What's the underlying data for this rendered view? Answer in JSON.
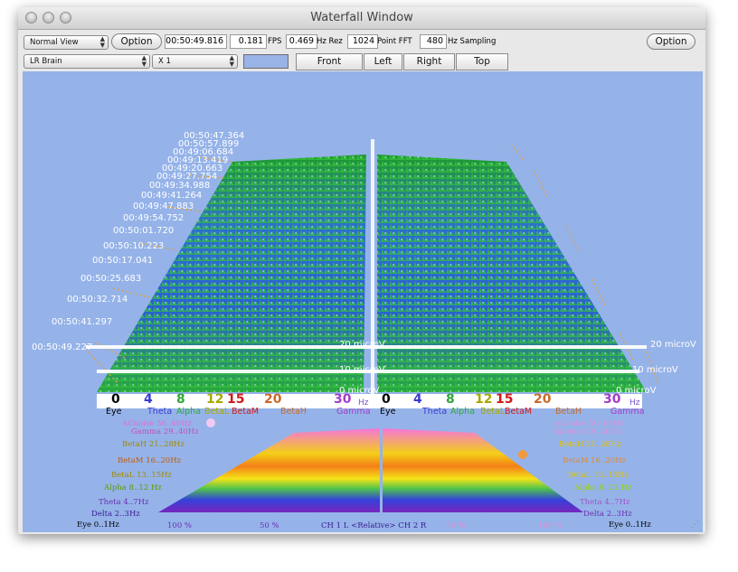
{
  "window": {
    "title": "Waterfall Window"
  },
  "toolbar": {
    "view_mode": "Normal View",
    "option_label": "Option",
    "time_value": "00:50:49.816",
    "fps_value": "0.181",
    "fps_label": "FPS",
    "rez_value": "0.469",
    "rez_label": "Hz Rez",
    "fft_value": "1024",
    "fft_label": "Point FFT",
    "sampling_value": "480",
    "sampling_label": "Hz Sampling",
    "option_right_label": "Option",
    "montage": "LR Brain",
    "scale": "X 1",
    "accent_color": "#9ab3e6",
    "view_buttons": [
      "Front",
      "Left",
      "Right",
      "Top"
    ]
  },
  "waterfall": {
    "timestamps": [
      "00:50:47.364",
      "00:50:57.899",
      "00:49:06.684",
      "00:49:13.419",
      "00:49:20.663",
      "00:49:27.754",
      "00:49:34.988",
      "00:49:41.264",
      "00:49:47.883",
      "00:49:54.752",
      "00:50:01.720",
      "00:50:10.223",
      "00:50:17.041",
      "00:50:25.683",
      "00:50:32.714",
      "00:50:41.297",
      "00:50:49.227"
    ],
    "microvolt_labels": [
      "20 microV",
      "10 microV",
      "0 microV"
    ],
    "microvolt_labels_right": [
      "20 microV",
      "10 microV",
      "0 microV"
    ],
    "freq_ticks_left": [
      "0",
      "4",
      "8",
      "12",
      "15",
      "20",
      "30"
    ],
    "freq_ticks_right": [
      "0",
      "4",
      "8",
      "12",
      "15",
      "20",
      "30"
    ],
    "hz_unit": "Hz",
    "bands_left": [
      "Eye",
      "Theta",
      "Alpha",
      "BetaL",
      "BetaM",
      "BetaH",
      "Gamma"
    ],
    "bands_right": [
      "Eye",
      "Theta",
      "Alpha",
      "BetaL",
      "BetaM",
      "BetaH",
      "Gamma"
    ]
  },
  "band_rows": {
    "left": [
      "ACnoise 50..60Hz",
      "Gamma 29..40Hz",
      "BetaH 21..28Hz",
      "BetaM 16..20Hz",
      "BetaL 13..15Hz",
      "Alpha 8..12 Hz",
      "Theta 4..7Hz",
      "Delta 2..3Hz",
      "Eye 0..1Hz"
    ],
    "right": [
      "ACnoise 50..60Hz",
      "Gamma 29..40Hz",
      "BetaH 21..28Hz",
      "BetaM 16..20Hz",
      "BetaL 13..15Hz",
      "Alpha 8..12 Hz",
      "Theta 4..7Hz",
      "Delta 2..3Hz",
      "Eye 0..1Hz"
    ],
    "row_colors": [
      "#d96fd4",
      "#c64dc0",
      "#e0c100",
      "#e06a00",
      "#d6a300",
      "#7bb800",
      "#9a56c8",
      "#6a2fb0",
      "#000000"
    ]
  },
  "footer": {
    "pct_left": "100 %",
    "pct_mid": "50 %",
    "channel_label": "CH 1 L  <Relative>  CH 2 R",
    "pct_right_mid": "50 %",
    "pct_right": "100 %"
  }
}
